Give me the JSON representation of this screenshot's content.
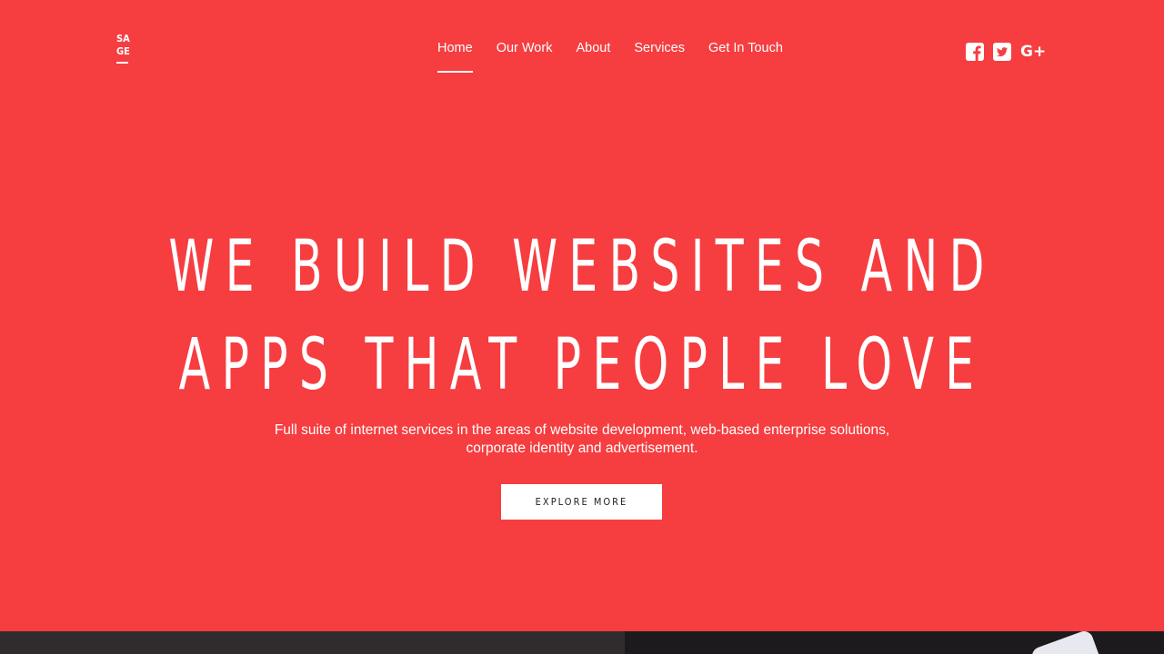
{
  "brand": {
    "logo_line1": "SA",
    "logo_line2": "GE"
  },
  "nav": {
    "items": [
      {
        "label": "Home",
        "active": true
      },
      {
        "label": "Our Work",
        "active": false
      },
      {
        "label": "About",
        "active": false
      },
      {
        "label": "Services",
        "active": false
      },
      {
        "label": "Get In Touch",
        "active": false
      }
    ]
  },
  "social": {
    "icons": [
      "facebook-icon",
      "twitter-icon",
      "google-plus-icon"
    ],
    "gplus_glyph": "G+"
  },
  "hero": {
    "headline_line1": "WE BUILD WEBSITES AND",
    "headline_line2": "APPS THAT PEOPLE LOVE",
    "subtitle_line1": "Full suite of internet services in the areas of website development, web-based enterprise solutions,",
    "subtitle_line2": "corporate identity and advertisement.",
    "cta_label": "EXPLORE MORE"
  },
  "colors": {
    "background": "#f63d40",
    "text": "#ffffff",
    "button_bg": "#ffffff",
    "button_text": "#222222",
    "footer_dark": "#302c2e"
  }
}
